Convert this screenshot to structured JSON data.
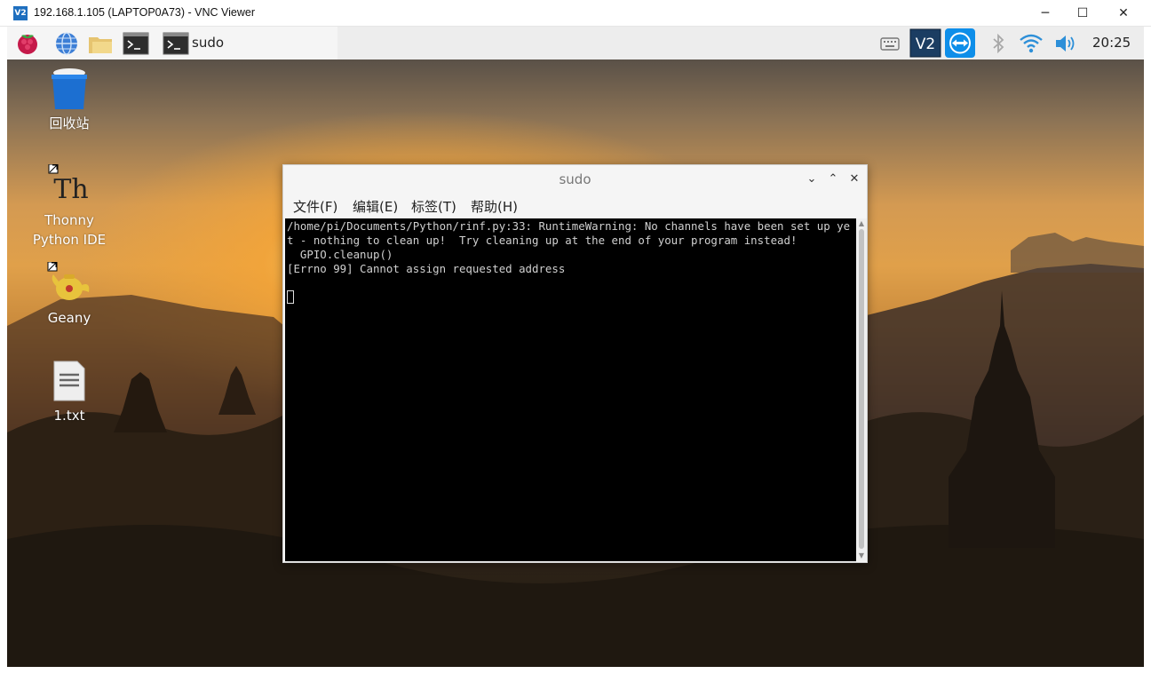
{
  "vnc": {
    "title": "192.168.1.105 (LAPTOP0A73) - VNC Viewer",
    "logo": "V2",
    "controls": {
      "minimize": "─",
      "maximize": "☐",
      "close": "✕"
    }
  },
  "panel": {
    "task_label": "sudo",
    "clock": "20:25",
    "launchers": [
      "raspberry-menu-icon",
      "web-browser-icon",
      "file-manager-icon",
      "terminal-icon"
    ],
    "tray": [
      "keyboard-icon",
      "vnc-server-icon",
      "teamviewer-icon",
      "bluetooth-icon",
      "wifi-icon",
      "volume-icon"
    ]
  },
  "desktop_icons": [
    {
      "name": "trash",
      "label": "回收站"
    },
    {
      "name": "thonny",
      "label": "Thonny Python IDE"
    },
    {
      "name": "geany",
      "label": "Geany"
    },
    {
      "name": "text-file",
      "label": "1.txt"
    }
  ],
  "terminal": {
    "title": "sudo",
    "menu": [
      "文件(F)",
      "编辑(E)",
      "标签(T)",
      "帮助(H)"
    ],
    "output": "/home/pi/Documents/Python/rinf.py:33: RuntimeWarning: No channels have been set up yet - nothing to clean up!  Try cleaning up at the end of your program instead!\n  GPIO.cleanup()\n[Errno 99] Cannot assign requested address"
  },
  "colors": {
    "terminal_bg": "#000000",
    "terminal_fg": "#d0d0d0",
    "panel_bg": "#ededed",
    "vnc_blue": "#1e6fbf"
  }
}
